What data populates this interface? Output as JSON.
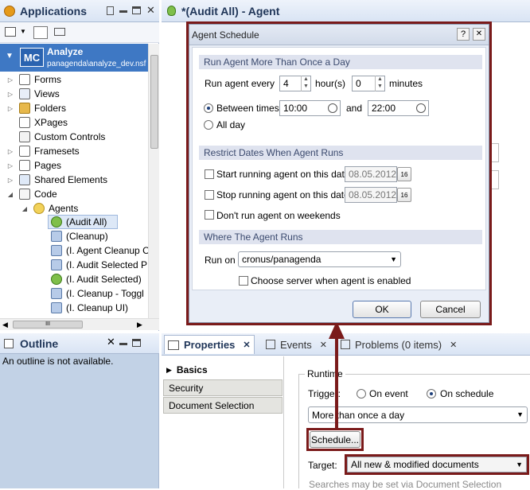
{
  "applications": {
    "title": "Applications",
    "app_name": "Analyze",
    "app_badge": "MC",
    "app_path": "panagenda\\analyze_dev.nsf",
    "tree": [
      "Forms",
      "Views",
      "Folders",
      "XPages",
      "Custom Controls",
      "Framesets",
      "Pages",
      "Shared Elements",
      "Code",
      "Agents",
      "(Audit All)",
      "(Cleanup)",
      "(I. Agent Cleanup C",
      "(I. Audit Selected P",
      "(I. Audit Selected)",
      "(I. Cleanup - Toggl",
      "(I. Cleanup UI)"
    ],
    "hscroll_thumb": "III"
  },
  "outline": {
    "title": "Outline",
    "empty_text": "An outline is not available."
  },
  "editor": {
    "title": "*(Audit All) - Agent"
  },
  "dialog": {
    "title": "Agent Schedule",
    "help": "?",
    "close": "✕",
    "sec1": "Run Agent More Than Once a Day",
    "run_every_label": "Run agent every",
    "hours_value": "4",
    "hours_unit": "hour(s)",
    "minutes_value": "0",
    "minutes_unit": "minutes",
    "between_label": "Between times",
    "time_from": "10:00",
    "and_label": "and",
    "time_to": "22:00",
    "all_day_label": "All day",
    "sec2": "Restrict Dates When Agent Runs",
    "start_label": "Start running agent on this date",
    "start_date": "08.05.2012",
    "stop_label": "Stop running agent on this date",
    "stop_date": "08.05.2012",
    "weekends_label": "Don't run agent on weekends",
    "cal_badge": "16",
    "sec3": "Where The Agent Runs",
    "run_on_label": "Run on",
    "server_value": "cronus/panagenda",
    "choose_server_label": "Choose server when agent is enabled",
    "ok": "OK",
    "cancel": "Cancel"
  },
  "bottom": {
    "tabs": [
      "Properties",
      "Events",
      "Problems (0 items)"
    ],
    "side": [
      "Basics",
      "Security",
      "Document Selection"
    ],
    "runtime_label": "Runtime",
    "trigger_label": "Trigger:",
    "on_event": "On event",
    "on_schedule": "On schedule",
    "frequency": "More than once a day",
    "schedule_button": "Schedule...",
    "target_label": "Target:",
    "target_value": "All new & modified documents",
    "hint": "Searches may be set via Document Selection"
  }
}
